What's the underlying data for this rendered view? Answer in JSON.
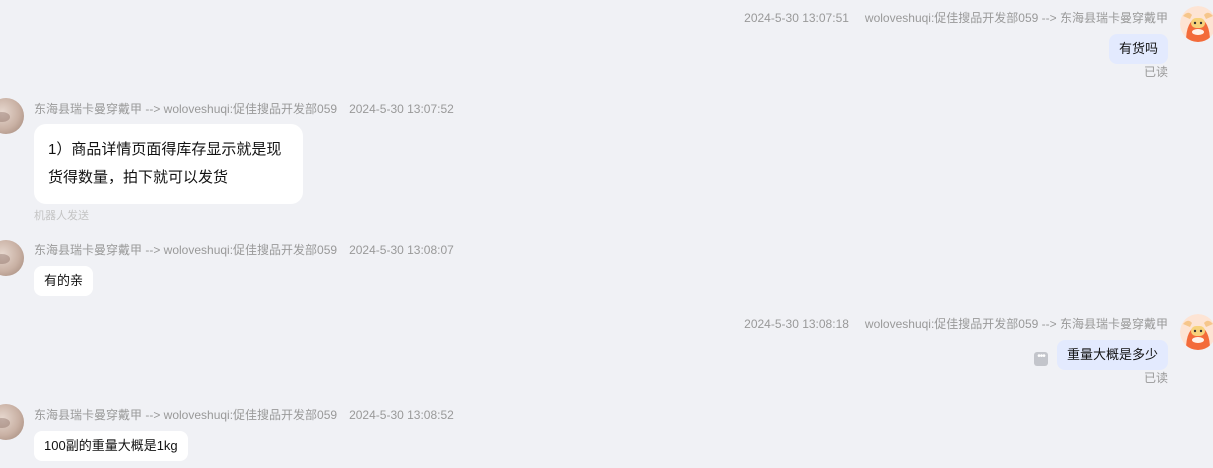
{
  "messages": [
    {
      "side": "right",
      "time": "2024-5-30 13:07:51",
      "route": "woloveshuqi:促佳搜品开发部059 --> 东海县瑞卡曼穿戴甲",
      "text": "有货吗",
      "read_label": "已读"
    },
    {
      "side": "left",
      "route": "东海县瑞卡曼穿戴甲 --> woloveshuqi:促佳搜品开发部059",
      "time": "2024-5-30 13:07:52",
      "text": "1）商品详情页面得库存显示就是现货得数量，拍下就可以发货",
      "robot_label": "机器人发送"
    },
    {
      "side": "left",
      "route": "东海县瑞卡曼穿戴甲 --> woloveshuqi:促佳搜品开发部059",
      "time": "2024-5-30 13:08:07",
      "text": "有的亲"
    },
    {
      "side": "right",
      "time": "2024-5-30 13:08:18",
      "route": "woloveshuqi:促佳搜品开发部059 --> 东海县瑞卡曼穿戴甲",
      "text": "重量大概是多少",
      "read_label": "已读",
      "more_icon": "ellipsis-icon"
    },
    {
      "side": "left",
      "route": "东海县瑞卡曼穿戴甲 --> woloveshuqi:促佳搜品开发部059",
      "time": "2024-5-30 13:08:52",
      "text": "100副的重量大概是1kg"
    }
  ],
  "icons": {
    "user_avatar": "seller-avatar-photo",
    "bot_avatar": "cartoon-bull-avatar-icon"
  },
  "colors": {
    "background": "#f0f1f5",
    "self_bubble": "#e3eafe",
    "other_bubble": "#ffffff",
    "meta_text": "#999999",
    "bot_avatar_orange": "#f36b3a"
  }
}
